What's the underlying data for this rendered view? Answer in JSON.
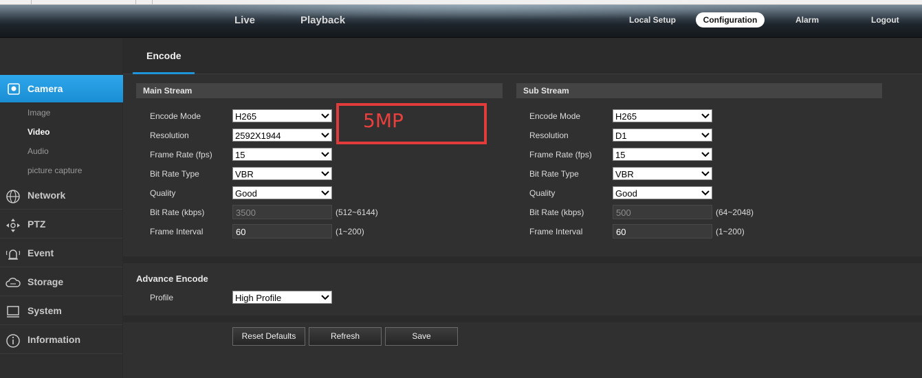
{
  "topnav": {
    "left": [
      "Live",
      "Playback"
    ],
    "local_setup": "Local Setup",
    "configuration": "Configuration",
    "alarm": "Alarm",
    "logout": "Logout"
  },
  "sidebar": {
    "camera": "Camera",
    "camera_sub": [
      "Image",
      "Video",
      "Audio",
      "picture capture"
    ],
    "network": "Network",
    "ptz": "PTZ",
    "event": "Event",
    "storage": "Storage",
    "system": "System",
    "information": "Information"
  },
  "tab": {
    "label": "Encode"
  },
  "main_stream": {
    "title": "Main Stream",
    "labels": [
      "Encode Mode",
      "Resolution",
      "Frame Rate (fps)",
      "Bit Rate Type",
      "Quality",
      "Bit Rate (kbps)",
      "Frame Interval"
    ],
    "encode_mode": "H265",
    "resolution": "2592X1944",
    "frame_rate": "15",
    "bit_rate_type": "VBR",
    "quality": "Good",
    "bit_rate": "3500",
    "bit_rate_range": "(512~6144)",
    "frame_interval": "60",
    "frame_interval_range": "(1~200)"
  },
  "sub_stream": {
    "title": "Sub Stream",
    "labels": [
      "Encode Mode",
      "Resolution",
      "Frame Rate (fps)",
      "Bit Rate Type",
      "Quality",
      "Bit Rate (kbps)",
      "Frame Interval"
    ],
    "encode_mode": "H265",
    "resolution": "D1",
    "frame_rate": "15",
    "bit_rate_type": "VBR",
    "quality": "Good",
    "bit_rate": "500",
    "bit_rate_range": "(64~2048)",
    "frame_interval": "60",
    "frame_interval_range": "(1~200)"
  },
  "annotation": {
    "text": "5MP",
    "color": "#e23b3b"
  },
  "advance": {
    "title": "Advance Encode",
    "profile_label": "Profile",
    "profile_value": "High Profile"
  },
  "buttons": {
    "reset": "Reset Defaults",
    "refresh": "Refresh",
    "save": "Save"
  },
  "colors": {
    "accent": "#1e95db",
    "background": "#2a2a2a"
  }
}
